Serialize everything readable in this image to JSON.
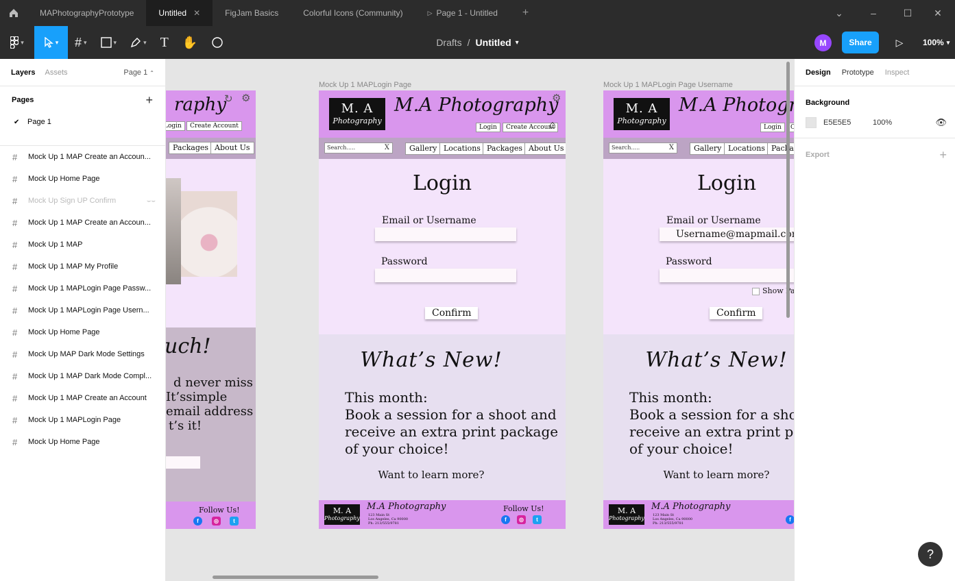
{
  "tabs": [
    "MAPhotographyPrototype",
    "Untitled",
    "FigJam Basics",
    "Colorful Icons (Community)",
    "Page 1 - Untitled"
  ],
  "breadcrumb": {
    "parent": "Drafts",
    "sep": "/",
    "file": "Untitled"
  },
  "user_initial": "M",
  "share_label": "Share",
  "zoom": "100%",
  "left_panel": {
    "tab_layers": "Layers",
    "tab_assets": "Assets",
    "page_selector": "Page 1",
    "pages_title": "Pages",
    "current_page": "Page 1",
    "layers": [
      "Mock Up 1 MAP Create an Accoun...",
      "Mock Up Home Page",
      "Mock Up Sign UP Confirm",
      "Mock Up 1 MAP Create an Accoun...",
      "Mock Up 1 MAP",
      "Mock Up 1 MAP My Profile",
      "Mock Up 1 MAPLogin Page Passw...",
      "Mock Up 1 MAPLogin Page Usern...",
      "Mock Up Home Page",
      "Mock Up MAP Dark Mode Settings",
      "Mock Up 1 MAP Dark Mode Compl...",
      "Mock Up 1 MAP Create an Account",
      "Mock Up 1 MAPLogin Page",
      "Mock Up Home Page"
    ]
  },
  "right_panel": {
    "tab_design": "Design",
    "tab_prototype": "Prototype",
    "tab_inspect": "Inspect",
    "background_title": "Background",
    "bg_hex": "E5E5E5",
    "bg_opacity": "100%",
    "export_title": "Export"
  },
  "frames": {
    "login_label": "Mock Up 1 MAPLogin Page",
    "username_label": "Mock Up 1 MAPLogin Page Username",
    "logo_line1": "M. A",
    "logo_line2": "Photography",
    "brand": "M.A Photography",
    "login_btn": "Login",
    "create_btn": "Create Account",
    "search_placeholder": "Search.....",
    "search_clear": "X",
    "nav": [
      "Gallery",
      "Locations",
      "Packages",
      "About Us"
    ],
    "login_title": "Login",
    "email_label": "Email or Username",
    "email_value": "Username@mapmail.com",
    "password_label": "Password",
    "show_password": "Show Pas",
    "confirm": "Confirm",
    "news_title": "What’s  New!",
    "news_line1": "This month:",
    "news_line2": "Book a session for a shoot and",
    "news_line3": "receive an extra print package",
    "news_line4": "of your choice!",
    "news_line2_cut": "Book a session for a shoot",
    "news_line3_cut": "receive an extra print pac",
    "learn_more": "Want to learn more?",
    "follow": "Follow Us!",
    "addr1": "123 Main St",
    "addr2": "Los Angeles, Ca 90000",
    "addr3": "Ph: 213/555/9781",
    "partial_brand": "raphy",
    "partial_login": "Login",
    "partial_nav1": "Packages",
    "partial_nav2": "About Us",
    "partial_text1": "uch!",
    "partial_text2": "d never miss",
    "partial_text3": "It’ssimple",
    "partial_text4": "email  address",
    "partial_text5": "t’s it!"
  }
}
